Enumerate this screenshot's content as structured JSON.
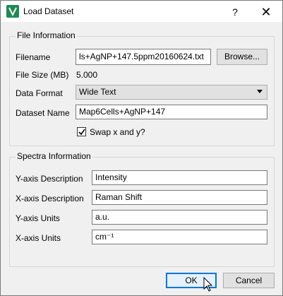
{
  "window": {
    "title": "Load Dataset",
    "help_glyph": "?",
    "close_glyph": "✕"
  },
  "file_info": {
    "group_title": "File Information",
    "filename_label": "Filename",
    "filename_value": "ls+AgNP+147.5ppm20160624.txt",
    "browse_label": "Browse...",
    "file_size_label": "File Size (MB)",
    "file_size_value": "5.000",
    "data_format_label": "Data Format",
    "data_format_value": "Wide Text",
    "dataset_name_label": "Dataset Name",
    "dataset_name_value": "Map6Cells+AgNP+147",
    "swap_label": "Swap x and y?",
    "swap_checked": true
  },
  "spectra_info": {
    "group_title": "Spectra Information",
    "y_desc_label": "Y-axis Description",
    "y_desc_value": "Intensity",
    "x_desc_label": "X-axis Description",
    "x_desc_value": "Raman Shift",
    "y_units_label": "Y-axis Units",
    "y_units_value": "a.u.",
    "x_units_label": "X-axis Units",
    "x_units_value": "cm⁻¹"
  },
  "buttons": {
    "ok_label": "OK",
    "cancel_label": "Cancel"
  },
  "colors": {
    "app_icon": "#1f8a52",
    "default_button_border": "#0078d7"
  }
}
